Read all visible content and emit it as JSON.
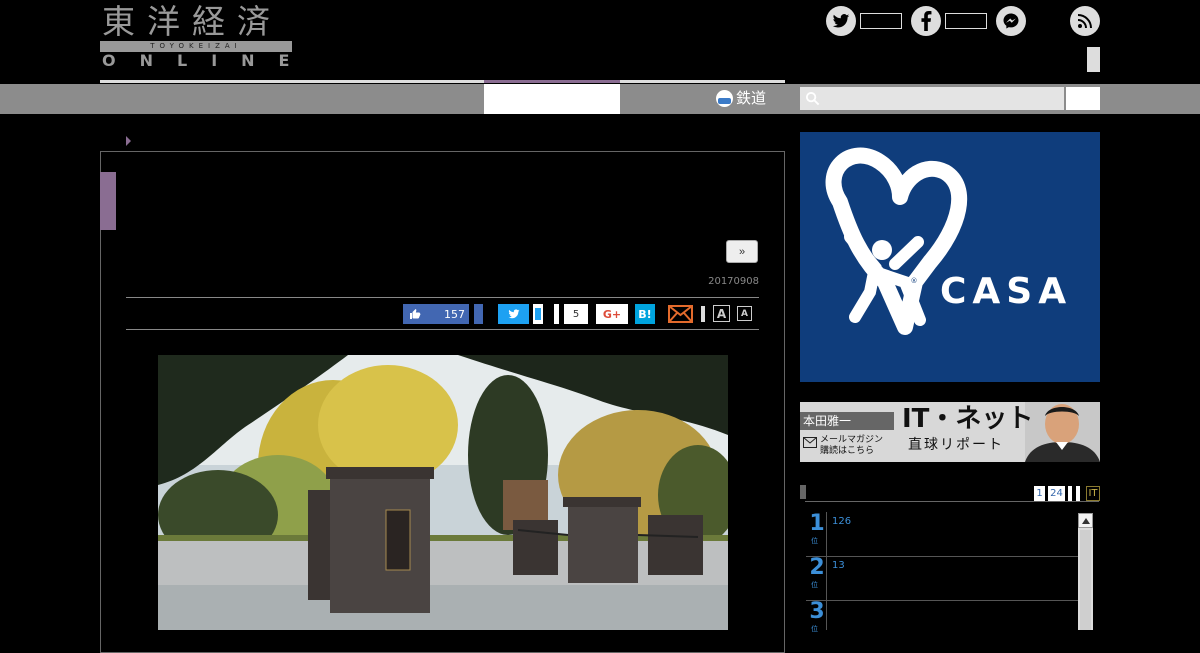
{
  "header": {
    "logo_kanji": "東洋経済",
    "logo_roman": "TOYOKEIZAI",
    "logo_online": "ONLINE"
  },
  "social": [
    {
      "name": "twitter",
      "icon": "twitter-icon"
    },
    {
      "name": "facebook",
      "icon": "facebook-icon"
    },
    {
      "name": "messenger",
      "icon": "messenger-icon"
    },
    {
      "name": "rss",
      "icon": "rss-icon"
    }
  ],
  "nav": {
    "rail_label": "鉄道"
  },
  "search": {
    "placeholder": "",
    "icon": "search-icon"
  },
  "article": {
    "next_label": "»",
    "date": "20170908",
    "share": {
      "like_count": "157",
      "comments_count": "5",
      "gplus_label": "G+",
      "hatena_label": "B!"
    },
    "font_large_label": "A",
    "font_small_label": "A"
  },
  "sidebar": {
    "ad": {
      "brand": "CASA",
      "reg_mark": "®",
      "bg_color": "#0f3d7c"
    },
    "banner": {
      "author": "本田雅一",
      "title": "IT・ネット",
      "subtitle": "直球リポート",
      "mail_line1": "メールマガジン",
      "mail_line2": "購読はこちら"
    },
    "ranking": {
      "tabs": [
        "1",
        "24",
        "",
        "",
        "IT"
      ],
      "items": [
        {
          "rank": "1",
          "suffix": "位",
          "count": "126"
        },
        {
          "rank": "2",
          "suffix": "位",
          "count": "13"
        },
        {
          "rank": "3",
          "suffix": "位",
          "count": ""
        }
      ]
    }
  },
  "colors": {
    "accent_purple": "#8a6d92",
    "nav_grey": "#8c8c8c",
    "facebook": "#4267b2",
    "twitter": "#1da1f2",
    "hatena": "#00a4de",
    "rank_blue": "#3c8fd8"
  }
}
